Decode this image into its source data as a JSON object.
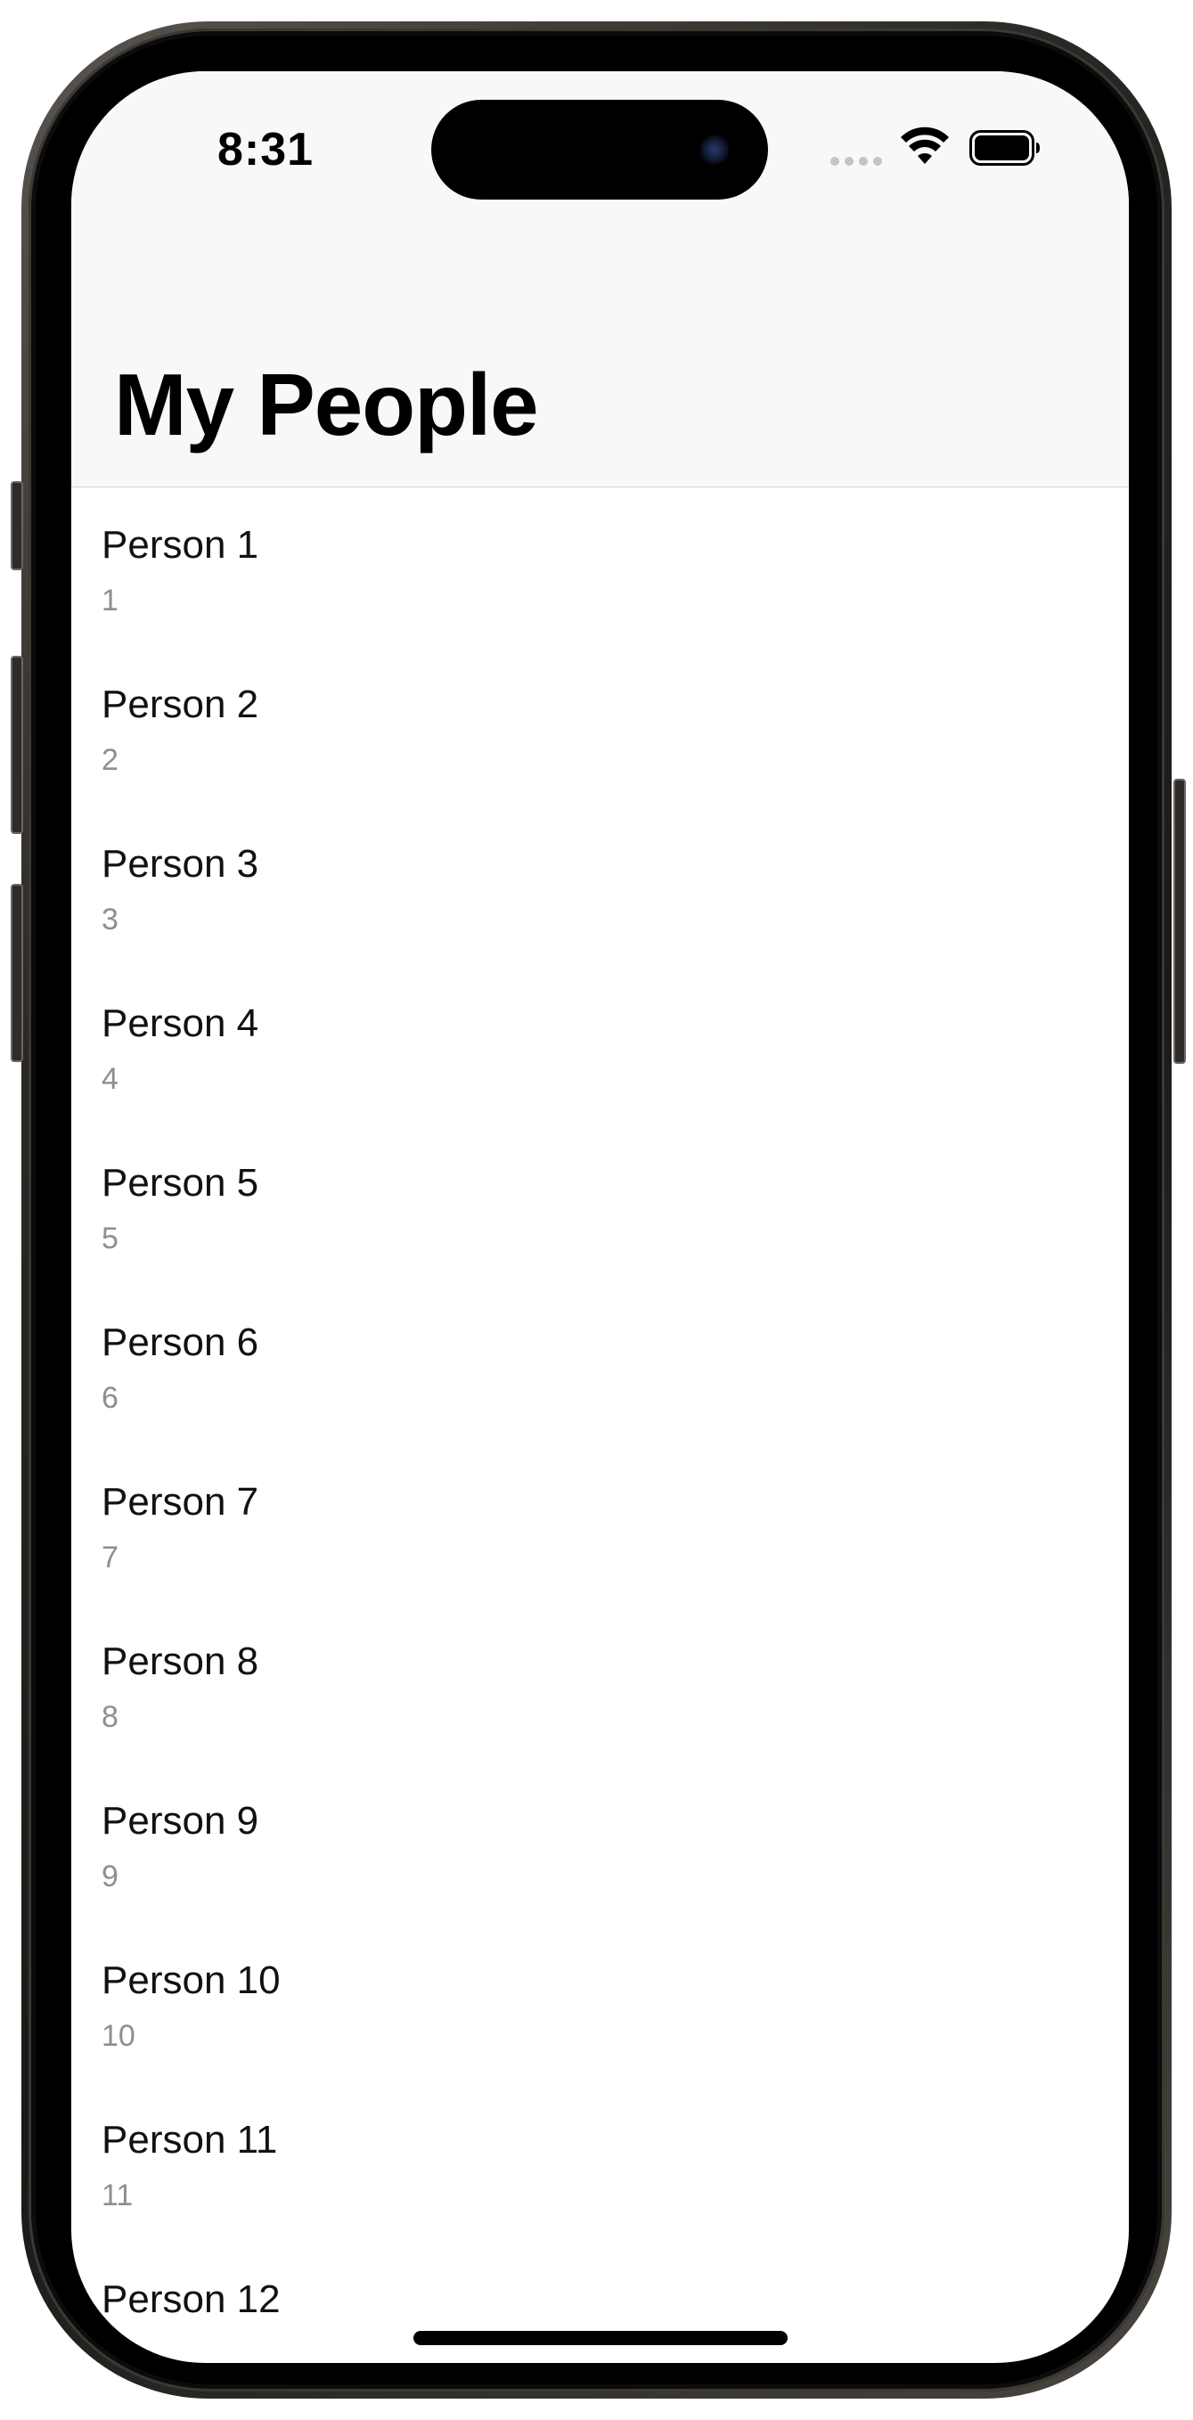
{
  "status_bar": {
    "time": "8:31",
    "icons": [
      "signal-dots-icon",
      "wifi-icon",
      "battery-icon"
    ]
  },
  "nav": {
    "title": "My People"
  },
  "people": [
    {
      "name": "Person 1",
      "number": "1"
    },
    {
      "name": "Person 2",
      "number": "2"
    },
    {
      "name": "Person 3",
      "number": "3"
    },
    {
      "name": "Person 4",
      "number": "4"
    },
    {
      "name": "Person 5",
      "number": "5"
    },
    {
      "name": "Person 6",
      "number": "6"
    },
    {
      "name": "Person 7",
      "number": "7"
    },
    {
      "name": "Person 8",
      "number": "8"
    },
    {
      "name": "Person 9",
      "number": "9"
    },
    {
      "name": "Person 10",
      "number": "10"
    },
    {
      "name": "Person 11",
      "number": "11"
    },
    {
      "name": "Person 12",
      "number": ""
    }
  ],
  "colors": {
    "header_background": "#f8f8f8",
    "secondary_text": "#8e8e93",
    "primary_text": "#111111"
  }
}
